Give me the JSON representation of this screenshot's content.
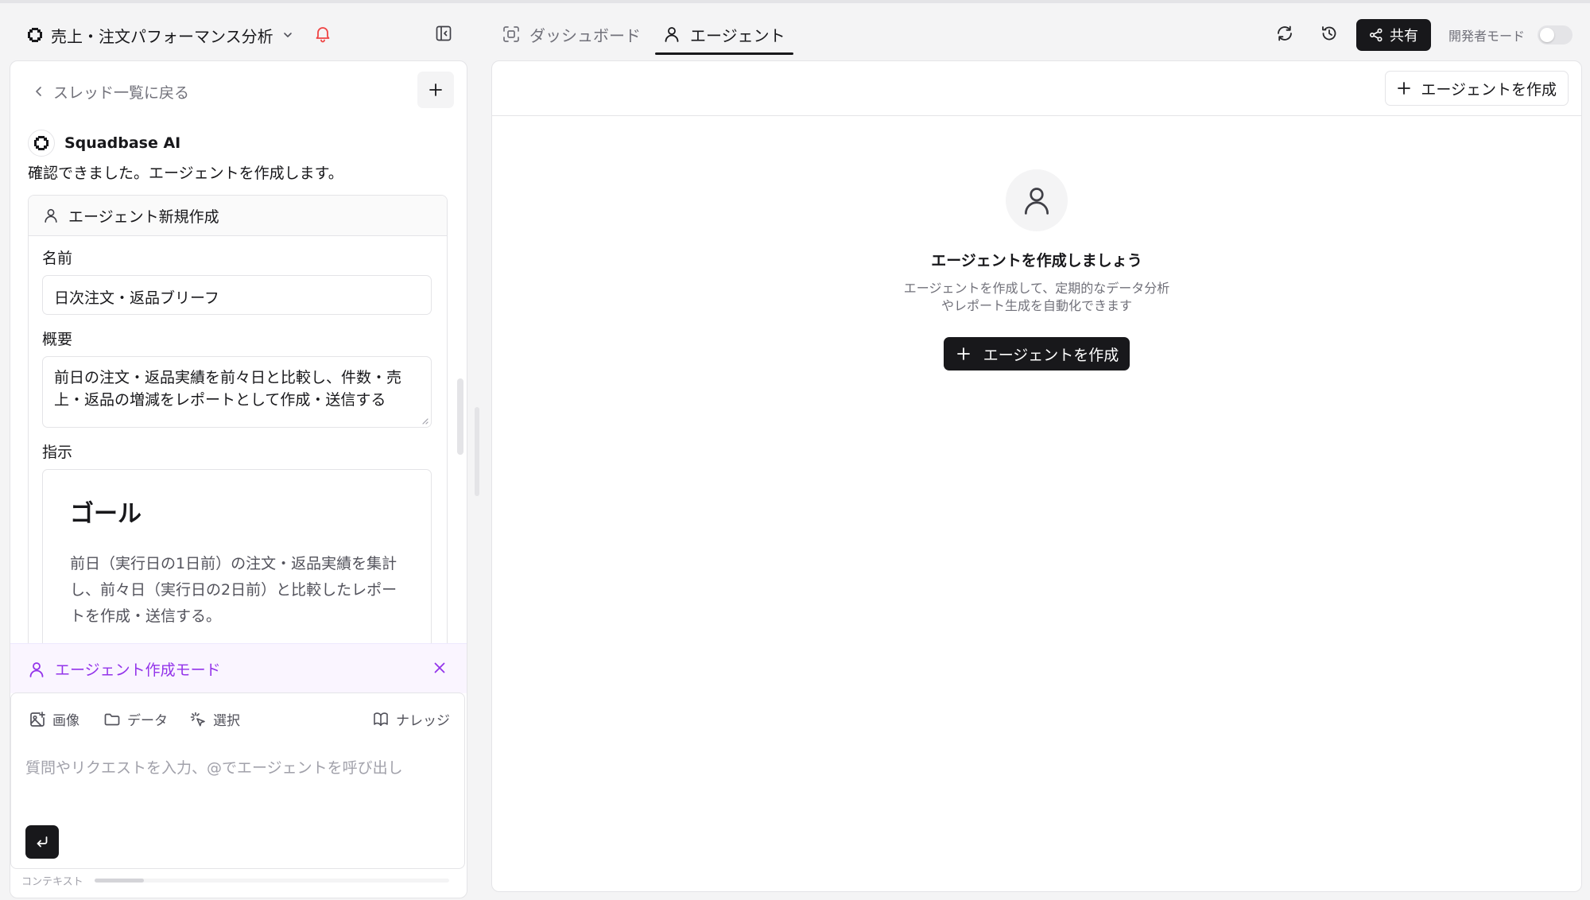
{
  "colors": {
    "accent": "#9333ea",
    "primary_button": "#18181b",
    "notification": "#ef4444"
  },
  "header": {
    "project_title": "売上・注文パフォーマンス分析",
    "tabs": [
      {
        "label": "ダッシュボード",
        "icon": "dashboard-icon",
        "active": false
      },
      {
        "label": "エージェント",
        "icon": "user-icon",
        "active": true
      }
    ],
    "share_label": "共有",
    "dev_mode_label": "開発者モード",
    "dev_mode_enabled": false
  },
  "left": {
    "back_label": "スレッド一覧に戻る",
    "ai_name": "Squadbase AI",
    "ai_message": "確認できました。エージェントを作成します。",
    "card": {
      "title": "エージェント新規作成",
      "name_label": "名前",
      "name_value": "日次注文・返品ブリーフ",
      "desc_label": "概要",
      "desc_value": "前日の注文・返品実績を前々日と比較し、件数・売上・返品の増減をレポートとして作成・送信する",
      "instr_label": "指示",
      "instr_heading": "ゴール",
      "instr_body": "前日（実行日の1日前）の注文・返品実績を集計し、前々日（実行日の2日前）と比較したレポートを作成・送信する。"
    },
    "mode_label": "エージェント作成モード",
    "composer": {
      "tools": {
        "image": "画像",
        "data": "データ",
        "select": "選択",
        "knowledge": "ナレッジ"
      },
      "placeholder": "質問やリクエストを入力、@でエージェントを呼び出し"
    },
    "context_label": "コンテキスト",
    "context_usage": 0.14
  },
  "right": {
    "create_button": "エージェントを作成",
    "empty_title": "エージェントを作成しましょう",
    "empty_description": "エージェントを作成して、定期的なデータ分析やレポート生成を自動化できます",
    "empty_create_button": "エージェントを作成"
  }
}
